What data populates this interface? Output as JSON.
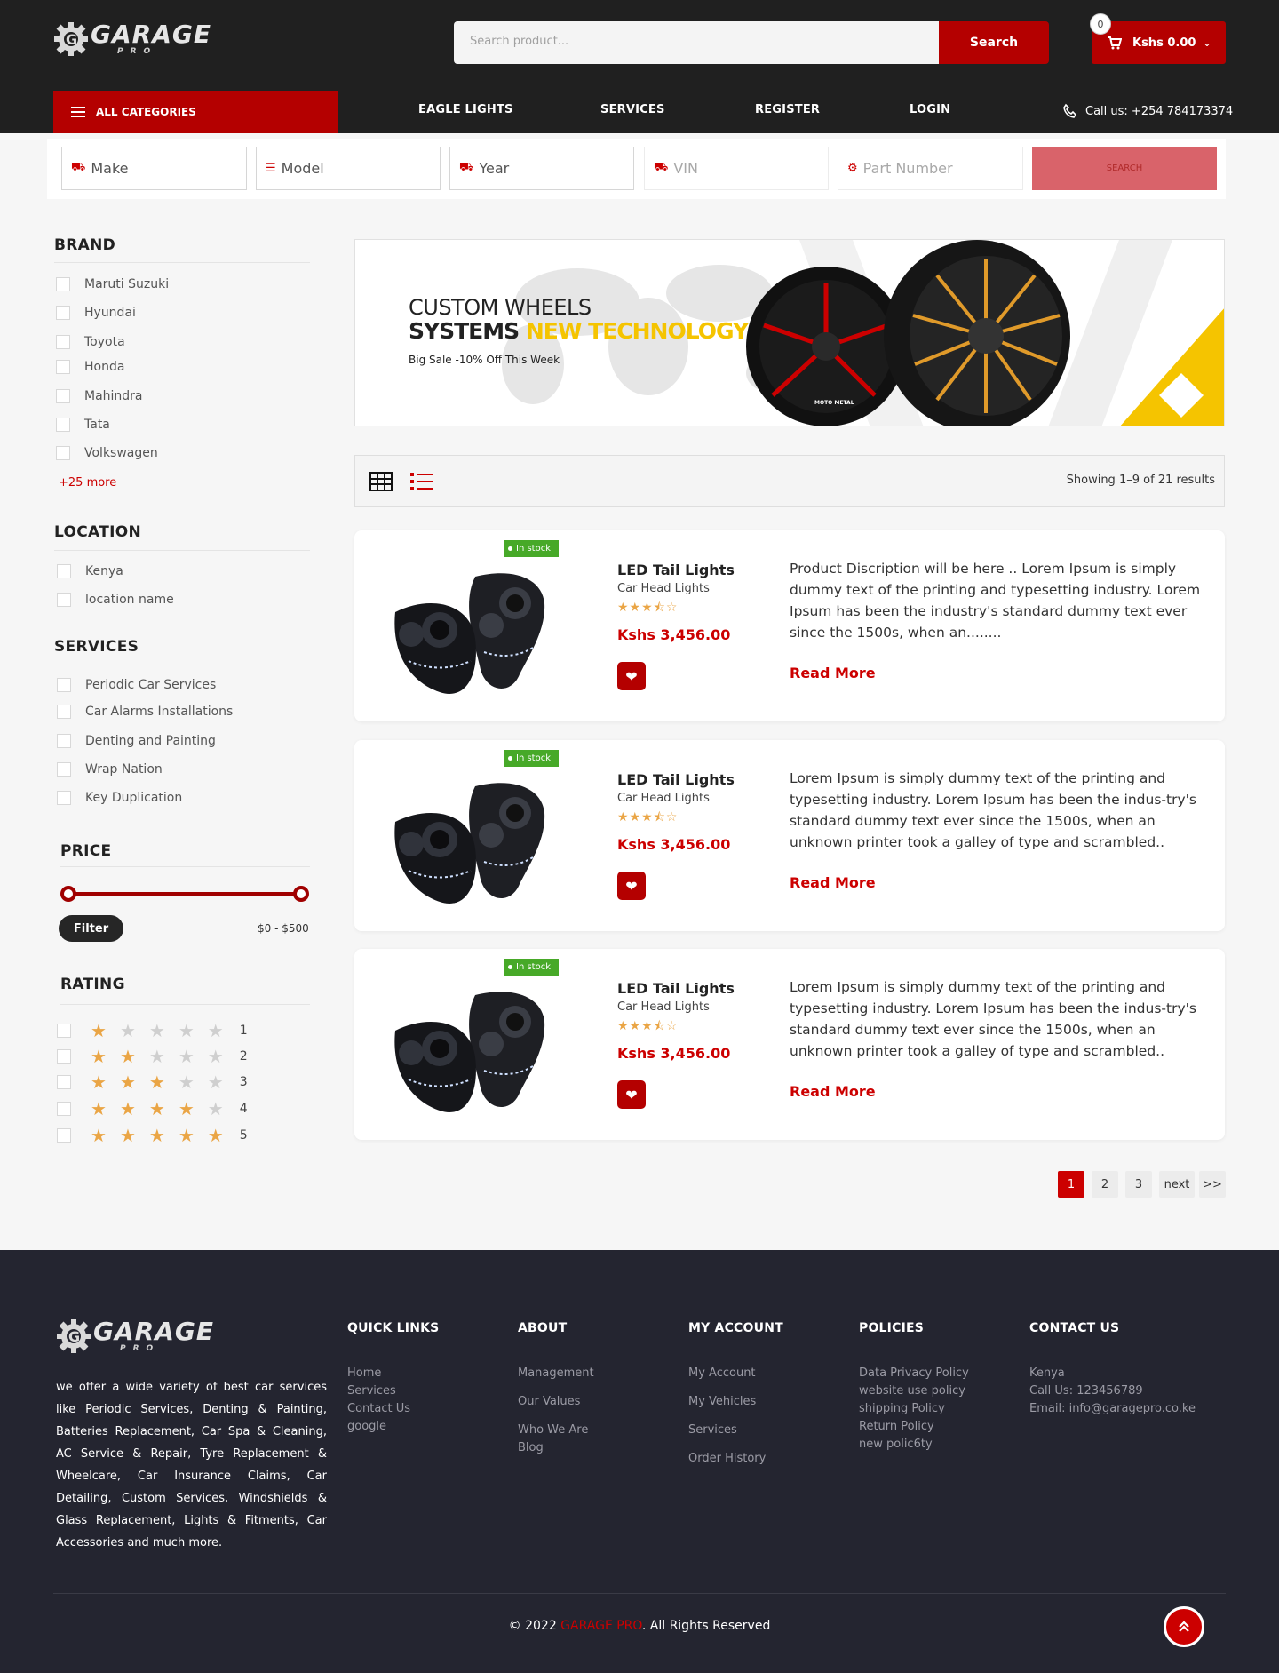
{
  "brand": {
    "name": "GARAGE",
    "sub": "PRO"
  },
  "header": {
    "search_placeholder": "Search product...",
    "search_button": "Search",
    "cart_count": "0",
    "cart_total": "Kshs 0.00"
  },
  "nav": {
    "all_categories": "ALL CATEGORIES",
    "links": [
      "EAGLE LIGHTS",
      "SERVICES",
      "REGISTER",
      "LOGIN"
    ],
    "call": "Call us: +254 784173374"
  },
  "vehicle_filter": {
    "make": "Make",
    "model": "Model",
    "year": "Year",
    "vin": "VIN",
    "part": "Part Number",
    "search": "SEARCH"
  },
  "sidebar": {
    "brand_title": "BRAND",
    "brands": [
      "Maruti Suzuki",
      "Hyundai",
      "Toyota",
      "Honda",
      "Mahindra",
      "Tata",
      "Volkswagen"
    ],
    "more": "+25 more",
    "location_title": "LOCATION",
    "locations": [
      "Kenya",
      "location name"
    ],
    "services_title": "SERVICES",
    "services": [
      "Periodic Car Services",
      "Car Alarms Installations",
      "Denting and Painting",
      "Wrap Nation",
      "Key Duplication"
    ],
    "price_title": "PRICE",
    "price_min": 0,
    "price_max": 500,
    "filter_button": "Filter",
    "price_range": "$0 - $500",
    "rating_title": "RATING",
    "ratings": [
      "1",
      "2",
      "3",
      "4",
      "5"
    ]
  },
  "banner": {
    "line1": "CUSTOM WHEELS",
    "line2a": "SYSTEMS",
    "line2b": "NEW TECHNOLOGY",
    "line3": "Big Sale -10% Off This Week",
    "wheel_label": "MOTO METAL"
  },
  "toolbar": {
    "showing": "Showing 1–9 of 21 results"
  },
  "products": [
    {
      "badge": "In stock",
      "title": "LED Tail Lights",
      "subtitle": "Car Head Lights",
      "rating": 3.5,
      "price": "Kshs 3,456.00",
      "description": "Product Discription will be here .. Lorem Ipsum is simply dummy text of the printing and typesetting industry. Lorem Ipsum has been the industry's standard dummy text ever since the 1500s, when an........",
      "read_more": "Read More"
    },
    {
      "badge": "In stock",
      "title": "LED Tail Lights",
      "subtitle": "Car Head Lights",
      "rating": 3.5,
      "price": "Kshs 3,456.00",
      "description": "Lorem Ipsum is simply dummy text of the printing and typesetting industry. Lorem Ipsum has been the indus-try's standard dummy text ever since the 1500s, when an unknown printer took a galley of type and scrambled..",
      "read_more": "Read More"
    },
    {
      "badge": "In stock",
      "title": "LED Tail Lights",
      "subtitle": "Car Head Lights",
      "rating": 3.5,
      "price": "Kshs 3,456.00",
      "description": "Lorem Ipsum is simply dummy text of the printing and typesetting industry. Lorem Ipsum has been the indus-try's standard dummy text ever since the 1500s, when an unknown printer took a galley of type and scrambled..",
      "read_more": "Read More"
    }
  ],
  "pagination": [
    "1",
    "2",
    "3",
    "next",
    ">>"
  ],
  "footer": {
    "about": "we offer a wide variety of best car services like Periodic Services, Denting & Painting, Batteries Replacement, Car Spa & Cleaning, AC Service & Repair, Tyre Replacement & Wheelcare, Car Insurance Claims, Car Detailing, Custom Services, Windshields & Glass Replacement, Lights & Fitments, Car Accessories and much more.",
    "columns": [
      {
        "title": "QUICK LINKS",
        "links": [
          "Home",
          "Services",
          "Contact Us",
          "google"
        ]
      },
      {
        "title": "ABOUT",
        "links": [
          "Management",
          "Our Values",
          "Who We Are",
          "Blog"
        ]
      },
      {
        "title": "MY ACCOUNT",
        "links": [
          "My Account",
          "My Vehicles",
          "Services",
          "Order History"
        ]
      },
      {
        "title": "POLICIES",
        "links": [
          "Data Privacy Policy",
          "website use policy",
          "shipping Policy",
          "Return Policy",
          "new polic6ty"
        ]
      },
      {
        "title": "CONTACT US",
        "links": [
          "Kenya",
          "Call Us: 123456789",
          "Email: info@garagepro.co.ke"
        ]
      }
    ],
    "copyright_pre": "© 2022 ",
    "copyright_brand": "GARAGE PRO",
    "copyright_post": ". All Rights Reserved"
  },
  "colors": {
    "accent": "#b40000",
    "dark": "#202020",
    "footer": "#242530",
    "star": "#eaa545",
    "stock": "#47a928"
  }
}
